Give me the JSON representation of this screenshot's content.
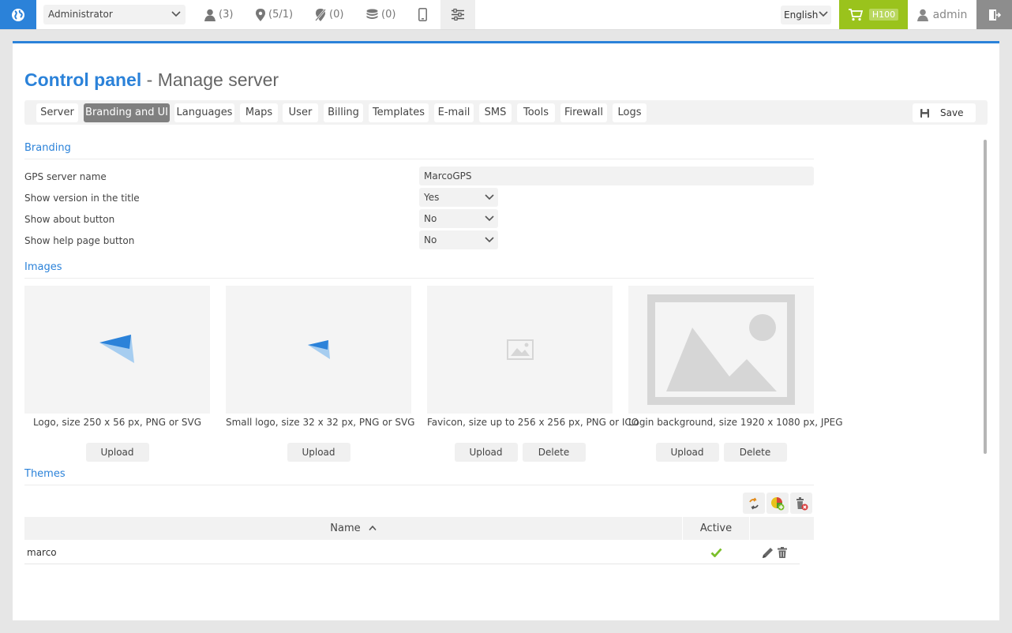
{
  "topbar": {
    "role": "Administrator",
    "users_count": "(3)",
    "objects_count": "(5/1)",
    "unused_count": "(0)",
    "billing_count": "(0)",
    "language": "English",
    "plan": "H100",
    "username": "admin",
    "brand_color": "#2b82d9",
    "cart_color": "#9ac31c"
  },
  "page": {
    "title": "Control panel",
    "separator": " - ",
    "subtitle": "Manage server"
  },
  "tabs": [
    "Server",
    "Branding and UI",
    "Languages",
    "Maps",
    "User",
    "Billing",
    "Templates",
    "E-mail",
    "SMS",
    "Tools",
    "Firewall",
    "Logs"
  ],
  "active_tab": "Branding and UI",
  "save_label": "Save",
  "branding": {
    "section_title": "Branding",
    "fields": [
      {
        "label": "GPS server name",
        "value": "MarcoGPS"
      },
      {
        "label": "Show version in the title",
        "value": "Yes"
      },
      {
        "label": "Show about button",
        "value": "No"
      },
      {
        "label": "Show help page button",
        "value": "No"
      }
    ]
  },
  "images": {
    "section_title": "Images",
    "cards": [
      {
        "caption": "Logo, size 250 x 56 px, PNG or SVG",
        "upload": "Upload"
      },
      {
        "caption": "Small logo, size 32 x 32 px, PNG or SVG",
        "upload": "Upload"
      },
      {
        "caption": "Favicon, size up to 256 x 256 px, PNG or ICO",
        "upload": "Upload",
        "delete": "Delete"
      },
      {
        "caption": "Login background, size 1920 x 1080 px, JPEG",
        "upload": "Upload",
        "delete": "Delete"
      }
    ]
  },
  "themes": {
    "section_title": "Themes",
    "columns": {
      "name": "Name",
      "active": "Active"
    },
    "rows": [
      {
        "name": "marco",
        "active": true
      }
    ]
  }
}
